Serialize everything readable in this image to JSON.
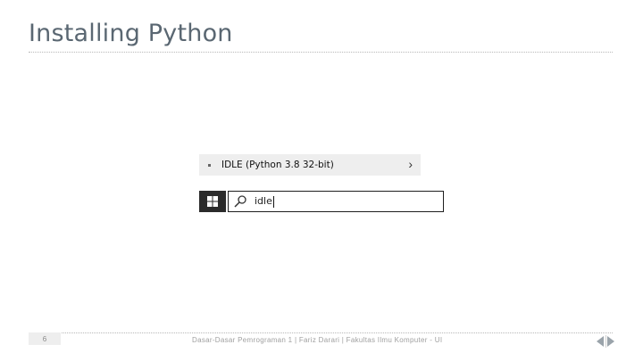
{
  "slide": {
    "title": "Installing Python",
    "page_number": "6",
    "footer": "Dasar-Dasar Pemrograman 1 | Fariz Darari | Fakultas Ilmu Komputer - UI"
  },
  "start_menu": {
    "result": {
      "label": "IDLE (Python 3.8 32-bit)",
      "arrow_icon": "chevron-right-icon"
    },
    "windows_icon": "windows-logo-icon",
    "search": {
      "icon": "search-icon",
      "value": "idle"
    }
  },
  "colors": {
    "title": "#5a6772",
    "result_bg": "#eeeeee",
    "taskbar_button": "#2b2b2b",
    "search_border": "#1e1e1e"
  }
}
